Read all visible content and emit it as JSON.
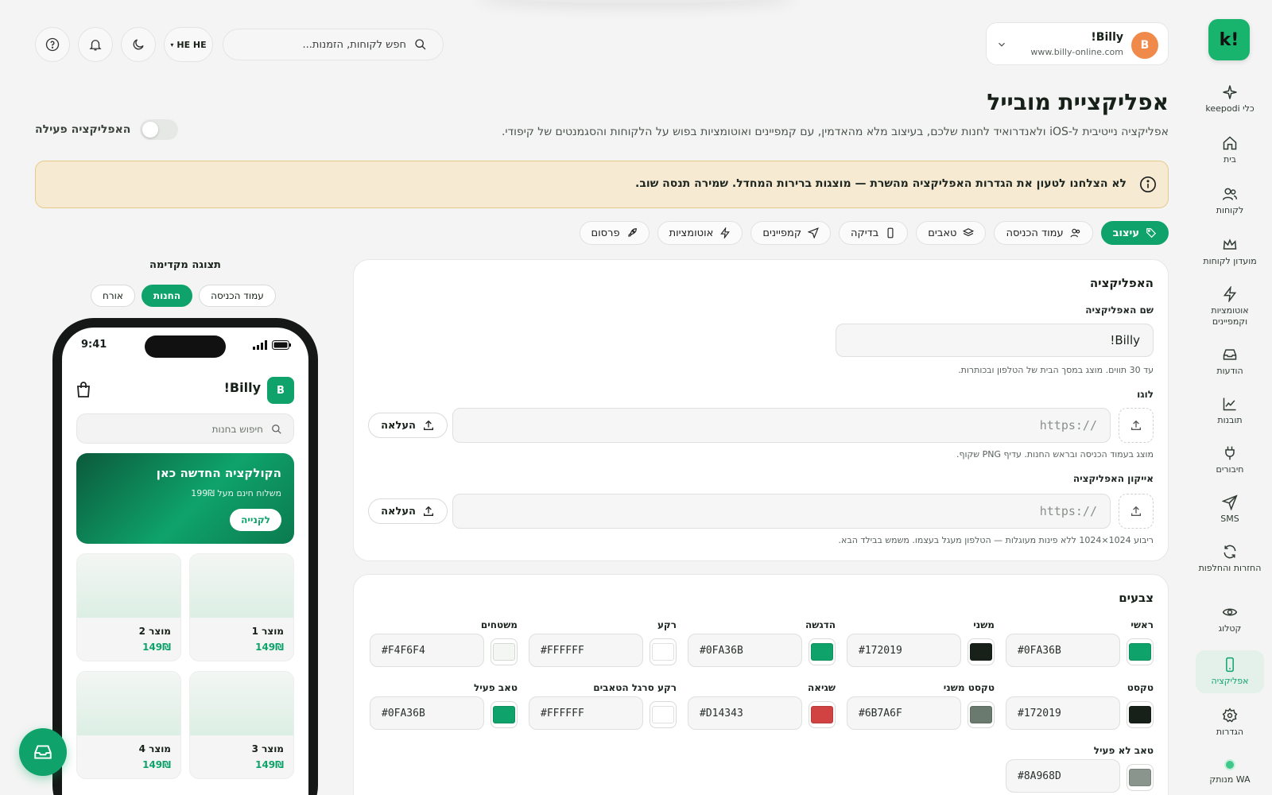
{
  "sidebar": {
    "logo_text": "!k",
    "items": [
      {
        "label": "כלי keepodi",
        "icon": "sparkle-icon"
      },
      {
        "label": "בית",
        "icon": "home-icon"
      },
      {
        "label": "לקוחות",
        "icon": "users-icon"
      },
      {
        "label": "מועדון לקוחות",
        "icon": "crown-icon"
      },
      {
        "label": "אוטומציות וקמפיינים",
        "icon": "bolt-icon"
      },
      {
        "label": "הודעות",
        "icon": "inbox-icon"
      },
      {
        "label": "תובנות",
        "icon": "chart-icon"
      },
      {
        "label": "חיבורים",
        "icon": "plug-icon"
      },
      {
        "label": "SMS",
        "icon": "send-icon"
      },
      {
        "label": "החזרות והחלפות",
        "icon": "refresh-icon"
      },
      {
        "label": "קטלוג",
        "icon": "eye-icon"
      },
      {
        "label": "אפליקציה",
        "icon": "phone-icon"
      },
      {
        "label": "הגדרות",
        "icon": "gear-icon"
      },
      {
        "label": "WA מנותק",
        "icon": "status-dot-icon"
      }
    ],
    "active_index": 11
  },
  "account": {
    "avatar_letter": "B",
    "name": "Billy!",
    "url": "www.billy-online.com"
  },
  "search": {
    "placeholder": "חפש לקוחות, הזמנות..."
  },
  "language": {
    "label": "HE HE"
  },
  "page": {
    "title": "אפליקציית מובייל",
    "description": "אפליקציה נייטיבית ל-iOS ולאנדרואיד לחנות שלכם, בעיצוב מלא מהאדמין, עם קמפיינים ואוטומציות בפוש על הלקוחות והסגמנטים של קיפודי.",
    "toggle_label": "האפליקציה פעילה",
    "toggle_on": false
  },
  "alert": {
    "text": "לא הצלחנו לטעון את הגדרות האפליקציה מהשרת — מוצגות ברירות המחדל. שמירה תנסה שוב."
  },
  "tabs": [
    {
      "label": "עיצוב",
      "icon": "tag-icon",
      "active": true
    },
    {
      "label": "עמוד הכניסה",
      "icon": "users-icon",
      "active": false
    },
    {
      "label": "טאבים",
      "icon": "layers-icon",
      "active": false
    },
    {
      "label": "בדיקה",
      "icon": "phone-icon",
      "active": false
    },
    {
      "label": "קמפיינים",
      "icon": "send-icon",
      "active": false
    },
    {
      "label": "אוטומציות",
      "icon": "bolt-icon",
      "active": false
    },
    {
      "label": "פרסום",
      "icon": "rocket-icon",
      "active": false
    }
  ],
  "app_card": {
    "title": "האפליקציה",
    "name_label": "שם האפליקציה",
    "name_value": "Billy!",
    "name_hint": "עד 30 תווים. מוצג במסך הבית של הטלפון ובכותרות.",
    "logo_label": "לוגו",
    "logo_placeholder": "https://",
    "logo_hint": "מוצג בעמוד הכניסה ובראש החנות. עדיף PNG שקוף.",
    "icon_label": "אייקון האפליקציה",
    "icon_placeholder": "https://",
    "icon_hint": "ריבוע 1024×1024 ללא פינות מעוגלות — הטלפון מעגל בעצמו. משמש בבילד הבא.",
    "upload_label": "העלאה"
  },
  "colors_card": {
    "title": "צבעים",
    "fields": [
      {
        "label": "ראשי",
        "hex": "#0FA36B"
      },
      {
        "label": "משני",
        "hex": "#172019"
      },
      {
        "label": "הדגשה",
        "hex": "#0FA36B"
      },
      {
        "label": "רקע",
        "hex": "#FFFFFF"
      },
      {
        "label": "משטחים",
        "hex": "#F4F6F4"
      },
      {
        "label": "טקסט",
        "hex": "#172019"
      },
      {
        "label": "טקסט משני",
        "hex": "#6B7A6F"
      },
      {
        "label": "שגיאה",
        "hex": "#D14343"
      },
      {
        "label": "רקע סרגל הטאבים",
        "hex": "#FFFFFF"
      },
      {
        "label": "טאב פעיל",
        "hex": "#0FA36B"
      },
      {
        "label": "טאב לא פעיל",
        "hex": "#8A968D"
      }
    ]
  },
  "preview": {
    "title": "תצוגה מקדימה",
    "tabs": [
      {
        "label": "עמוד הכניסה",
        "active": false
      },
      {
        "label": "החנות",
        "active": true
      },
      {
        "label": "אורח",
        "active": false
      }
    ],
    "phone": {
      "time": "9:41",
      "logo_letter": "B",
      "store_name": "Billy!",
      "search_placeholder": "חיפוש בחנות",
      "banner_title": "הקולקציה החדשה כאן",
      "banner_subtitle": "משלוח חינם מעל 199₪",
      "banner_button": "לקנייה",
      "products": [
        {
          "name": "מוצר 1",
          "price": "149₪"
        },
        {
          "name": "מוצר 2",
          "price": "149₪"
        },
        {
          "name": "מוצר 3",
          "price": "149₪"
        },
        {
          "name": "מוצר 4",
          "price": "149₪"
        }
      ]
    }
  },
  "theme": {
    "accent": "#0FA36B",
    "alert_bg": "#F6EAD3",
    "alert_border": "#E7C98E"
  }
}
